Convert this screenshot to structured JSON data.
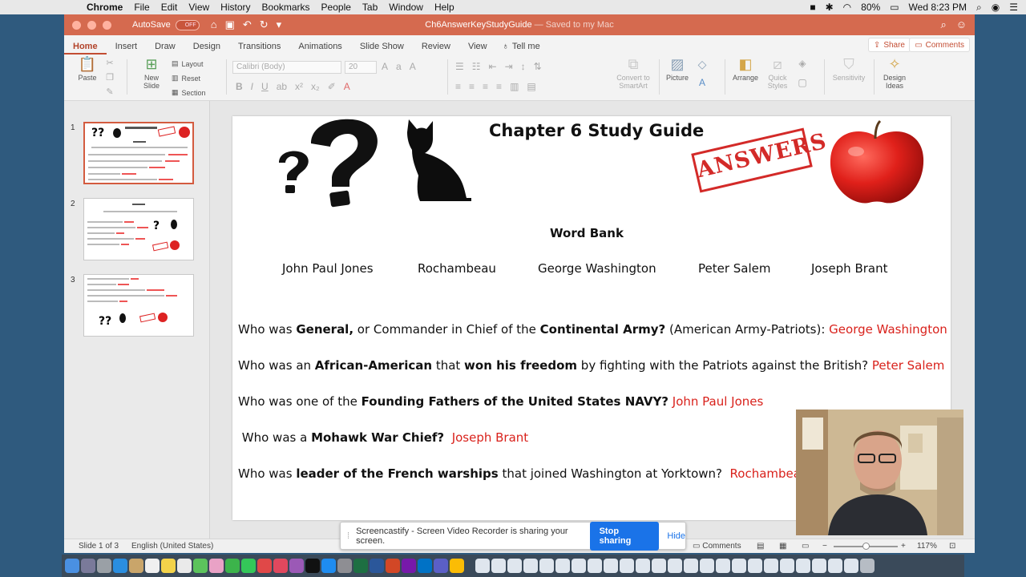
{
  "menubar": {
    "app": "Chrome",
    "items": [
      "File",
      "Edit",
      "View",
      "History",
      "Bookmarks",
      "People",
      "Tab",
      "Window",
      "Help"
    ],
    "battery": "80%",
    "clock": "Wed 8:23 PM"
  },
  "titlebar": {
    "autosave_label": "AutoSave",
    "autosave_state": "OFF",
    "doc_name": "Ch6AnswerKeyStudyGuide",
    "saved_status": "— Saved to my Mac"
  },
  "ribbon": {
    "tabs": [
      "Home",
      "Insert",
      "Draw",
      "Design",
      "Transitions",
      "Animations",
      "Slide Show",
      "Review",
      "View"
    ],
    "active_tab": "Home",
    "tell_me": "Tell me",
    "share_label": "Share",
    "comments_label": "Comments",
    "paste_label": "Paste",
    "new_slide_label": "New Slide",
    "layout_label": "Layout",
    "reset_label": "Reset",
    "section_label": "Section",
    "font_name": "Calibri (Body)",
    "font_size": "20",
    "convert_label": "Convert to SmartArt",
    "picture_label": "Picture",
    "arrange_label": "Arrange",
    "quick_styles_label": "Quick Styles",
    "sensitivity_label": "Sensitivity",
    "design_ideas_label": "Design Ideas"
  },
  "thumbnails": [
    {
      "number": "1",
      "active": true
    },
    {
      "number": "2",
      "active": false
    },
    {
      "number": "3",
      "active": false
    }
  ],
  "slide": {
    "title": "Chapter 6 Study Guide",
    "stamp_text": "ANSWERS",
    "word_bank_title": "Word Bank",
    "word_bank": [
      "John Paul Jones",
      "Rochambeau",
      "George Washington",
      "Peter Salem",
      "Joseph Brant"
    ],
    "questions": [
      {
        "pre": "Who was ",
        "b1": "General,",
        "mid": " or Commander in Chief of the ",
        "b2": "Continental Army?",
        "post": " (American Army-Patriots):  ",
        "answer": "George Washington"
      },
      {
        "pre": "Who was an ",
        "b1": "African-American",
        "mid": " that ",
        "b2": "won his freedom",
        "post": " by fighting with the Patriots against the British?  ",
        "answer": "Peter Salem"
      },
      {
        "pre": "Who was one of the ",
        "b1": "Founding Fathers of the United States NAVY?",
        "mid": " ",
        "b2": "",
        "post": "",
        "answer": "John Paul Jones"
      },
      {
        "pre": " Who was a ",
        "b1": "Mohawk War Chief?",
        "mid": "  ",
        "b2": "",
        "post": "",
        "answer": "Joseph Brant"
      },
      {
        "pre": "Who was ",
        "b1": "leader of the French warships",
        "mid": " that joined Washington at Yorktown?  ",
        "b2": "",
        "post": "",
        "answer": "Rochambeau"
      }
    ]
  },
  "statusbar": {
    "slide_info": "Slide 1 of 3",
    "language": "English (United States)",
    "comments": "Comments",
    "zoom": "117%"
  },
  "screencastify": {
    "message": "Screencastify - Screen Video Recorder is sharing your screen.",
    "stop_label": "Stop sharing",
    "hide_label": "Hide"
  }
}
